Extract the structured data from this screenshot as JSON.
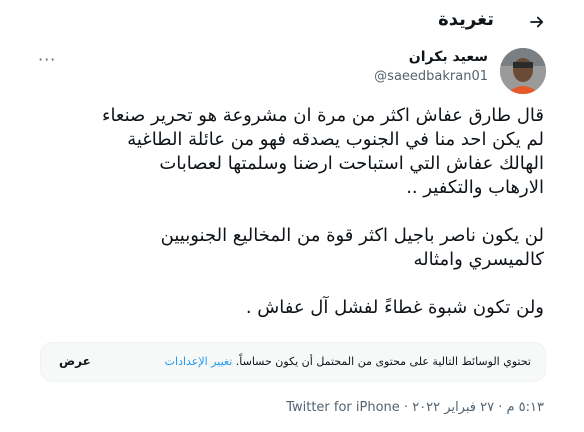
{
  "header": {
    "title": "تغريدة",
    "back_icon": "arrow-right-icon"
  },
  "author": {
    "name": "سعيد بكران",
    "handle": "@saeedbakran01"
  },
  "more_icon": "more-dots-icon",
  "tweet": {
    "p1": "قال طارق عفاش اكثر من مرة ان مشروعة هو تحرير صنعاء\nلم يكن احد منا في الجنوب يصدقه فهو من عائلة الطاغية\nالهالك عفاش التي استباحت ارضنا وسلمتها لعصابات\nالارهاب والتكفير ..",
    "p2": "لن يكون ناصر باجيل اكثر قوة من المخاليع الجنوبيين\nكالميسري وامثاله",
    "p3": "ولن تكون شبوة غطاءً لفشل آل عفاش ."
  },
  "media_warning": {
    "text": "تحتوي الوسائط التالية على محتوى من المحتمل أن يكون حساساً.",
    "link": "تغيير الإعدادات",
    "show_button": "عرض"
  },
  "meta": {
    "time_date": "٥:١٣ م · ٢٧ فبراير ٢٠٢٢ ·",
    "source": "Twitter for iPhone"
  }
}
